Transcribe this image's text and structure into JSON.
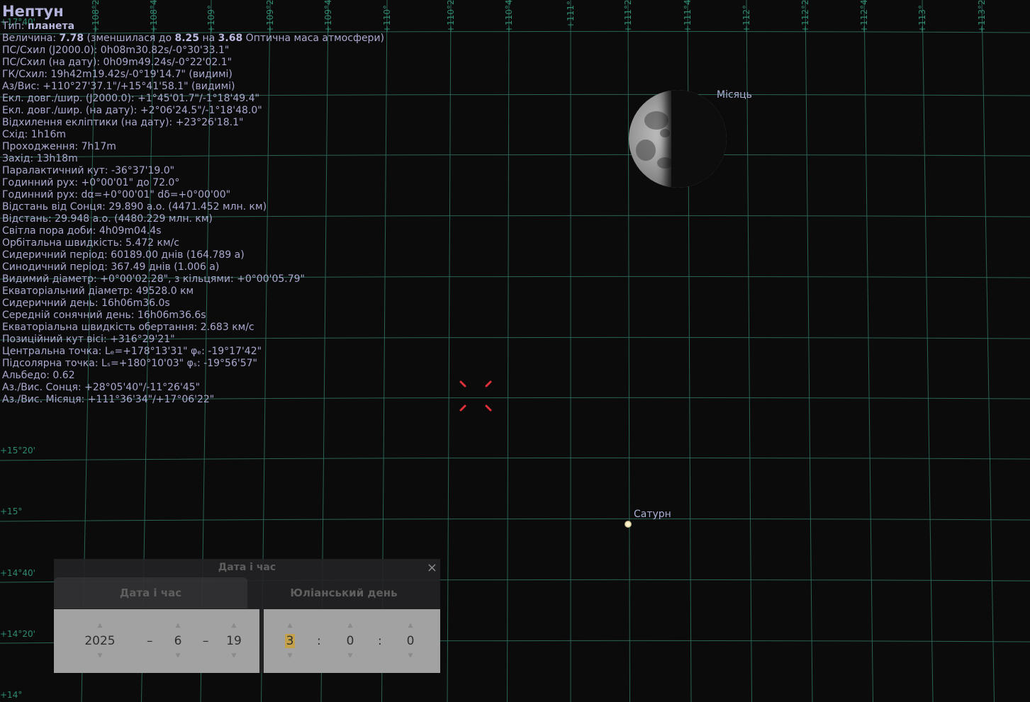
{
  "object_info": {
    "name": "Нептун",
    "type_label": "Тип: ",
    "type_value": "планета",
    "magnitude": {
      "label": "Величина: ",
      "value": "7.78",
      "text1": " (зменшилася до ",
      "value2": "8.25",
      "text2": " на ",
      "value3": "3.68",
      "text3": " Оптична маса атмосфери)"
    },
    "lines": [
      "ПС/Схил (J2000.0): 0h08m30.82s/-0°30'33.1\"",
      "ПС/Схил (на дату): 0h09m49.24s/-0°22'02.1\"",
      "ГК/Схил: 19h42m19.42s/-0°19'14.7\" (видимі)",
      "Аз/Вис: +110°27'37.1\"/+15°41'58.1\" (видимі)",
      "Екл. довг./шир. (J2000.0): +1°45'01.7\"/-1°18'49.4\"",
      "Екл. довг./шир. (на дату): +2°06'24.5\"/-1°18'48.0\"",
      "Відхилення екліптики (на дату): +23°26'18.1\"",
      "Схід: 1h16m",
      "Проходження: 7h17m",
      "Захід: 13h18m",
      "Паралактичний кут: -36°37'19.0\"",
      "Годинний рух: +0°00'01\" до 72.0°",
      "Годинний рух: dα=+0°00'01\" dδ=+0°00'00\"",
      "Відстань від Сонця: 29.890 а.о. (4471.452 млн. км)",
      "Відстань: 29.948 а.о. (4480.229 млн. км)",
      "Світла пора доби: 4h09m04.4s",
      "Орбітальна швидкість: 5.472 км/с",
      "Сидеричний період: 60189.00 днів (164.789 а)",
      "Синодичний період: 367.49 днів (1.006 а)",
      "Видимий діаметр: +0°00'02.28\", з кільцями: +0°00'05.79\"",
      "Екваторіальний діаметр: 49528.0 км",
      "Сидеричний день: 16h06m36.0s",
      "Середній сонячний день: 16h06m36.6s",
      "Екваторіальна швидкість обертання: 2.683 км/с",
      "Позиційний кут вісі: +316°29'21\"",
      "Центральна точка: Lₑ=+178°13'31\" φₑ: -19°17'42\"",
      "Підсолярна точка: Lₛ=+180°10'03\" φₛ: -19°56'57\"",
      "Альбедо: 0.62",
      "Аз./Вис. Сонця: +28°05'40\"/-11°26'45\"",
      "Аз./Вис. Місяця: +111°36'34\"/+17°06'22\""
    ]
  },
  "sky_labels": {
    "moon": "Місяць",
    "saturn": "Сатурн"
  },
  "grid": {
    "azimuth_labels": [
      "+108°20'",
      "+108°40'",
      "+109°",
      "+109°20'",
      "+109°40'",
      "+110°",
      "+110°20'",
      "+110°40'",
      "+111°",
      "+111°20'",
      "+111°40'",
      "+112°",
      "+112°20'",
      "+112°40'",
      "+113°",
      "+113°20'"
    ],
    "altitude_labels": [
      "+17°40'",
      "+15°20'",
      "+15°",
      "+14°40'",
      "+14°20'",
      "+14°"
    ]
  },
  "date_time_window": {
    "title": "Дата і час",
    "close": "×",
    "tabs": [
      "Дата і час",
      "Юліанський день"
    ],
    "year": "2025",
    "month": "6",
    "day": "19",
    "hour": "3",
    "minute": "0",
    "second": "0",
    "date_sep": "–",
    "time_sep": ":",
    "spin_up": "▲",
    "spin_down": "▼"
  },
  "colors": {
    "background": "#0b0b0c",
    "grid": "#2f6b5c",
    "info_text": "#a9a9cf",
    "reticle": "#e0303a"
  }
}
